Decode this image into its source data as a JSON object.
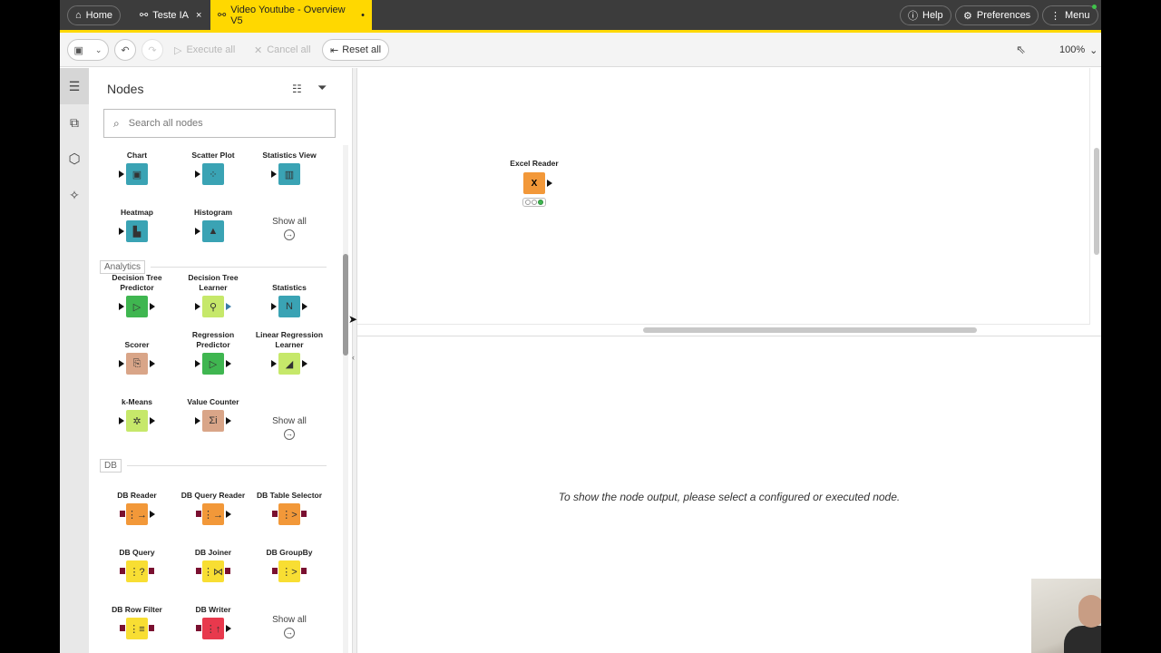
{
  "topbar": {
    "home_label": "Home",
    "tabs": [
      {
        "label": "Teste IA",
        "close": "×"
      },
      {
        "label": "Video Youtube - Overview V5",
        "close": "•"
      }
    ],
    "help_label": "Help",
    "preferences_label": "Preferences",
    "menu_label": "Menu",
    "accent_color": "#ffd800"
  },
  "toolbar": {
    "execute_all": "Execute all",
    "cancel_all": "Cancel all",
    "reset_all": "Reset all",
    "zoom": "100%"
  },
  "rail": {
    "items": [
      "description-icon",
      "node-repository-icon",
      "kai-icon",
      "ai-assistant-icon"
    ]
  },
  "panel": {
    "title": "Nodes",
    "search_placeholder": "Search all nodes",
    "nodes_top": [
      {
        "label": "Chart",
        "glyph": "▣"
      },
      {
        "label": "Scatter Plot",
        "glyph": "⁘"
      },
      {
        "label": "Statistics View",
        "glyph": "▥"
      },
      {
        "label": "Heatmap",
        "glyph": "▙"
      },
      {
        "label": "Histogram",
        "glyph": "▲"
      }
    ],
    "show_all": "Show all",
    "sections": {
      "analytics": "Analytics",
      "db": "DB"
    },
    "analytics_nodes": [
      {
        "label": "Decision Tree Predictor",
        "glyph": "▷"
      },
      {
        "label": "Decision Tree Learner",
        "glyph": "⚲"
      },
      {
        "label": "Statistics",
        "glyph": "N"
      },
      {
        "label": "Scorer",
        "glyph": "⎘"
      },
      {
        "label": "Regression Predictor",
        "glyph": "▷"
      },
      {
        "label": "Linear Regression Learner",
        "glyph": "◢"
      },
      {
        "label": "k-Means",
        "glyph": "✲"
      },
      {
        "label": "Value Counter",
        "glyph": "Σi"
      }
    ],
    "db_nodes": [
      {
        "label": "DB Reader",
        "glyph": "⋮→"
      },
      {
        "label": "DB Query Reader",
        "glyph": "⋮→"
      },
      {
        "label": "DB Table Selector",
        "glyph": "⋮>"
      },
      {
        "label": "DB Query",
        "glyph": "⋮?"
      },
      {
        "label": "DB Joiner",
        "glyph": "⋮⋈"
      },
      {
        "label": "DB GroupBy",
        "glyph": "⋮>"
      },
      {
        "label": "DB Row Filter",
        "glyph": "⋮≡"
      },
      {
        "label": "DB Writer",
        "glyph": "⋮↑"
      }
    ]
  },
  "canvas": {
    "node_label": "Excel Reader",
    "node_glyph": "X"
  },
  "output": {
    "message": "To show the node output, please select a configured or executed node."
  }
}
